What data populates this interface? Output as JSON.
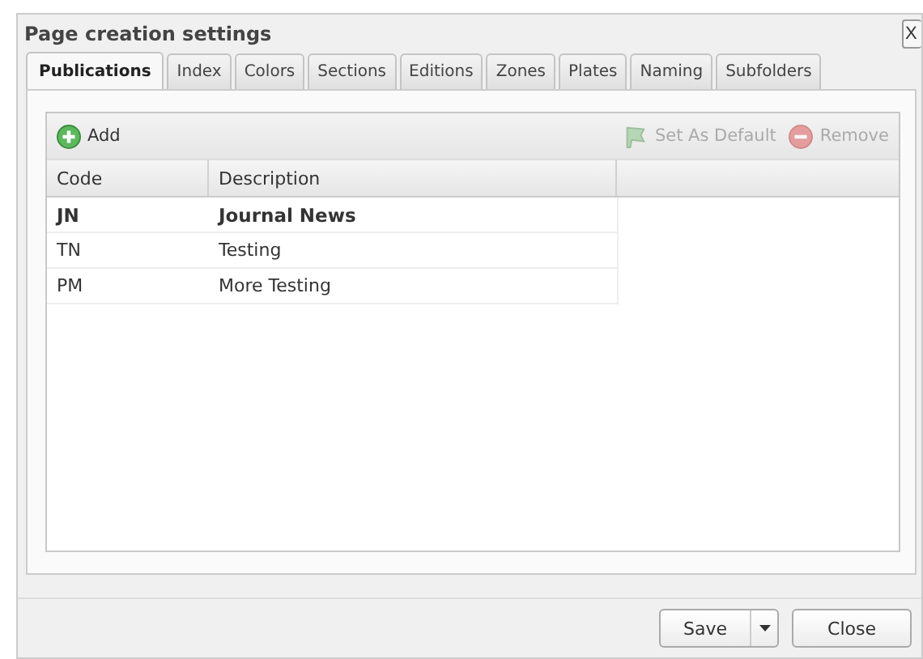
{
  "window": {
    "title": "Page creation settings",
    "close_label": "X"
  },
  "tabs": [
    {
      "label": "Publications",
      "selected": true
    },
    {
      "label": "Index",
      "selected": false
    },
    {
      "label": "Colors",
      "selected": false
    },
    {
      "label": "Sections",
      "selected": false
    },
    {
      "label": "Editions",
      "selected": false
    },
    {
      "label": "Zones",
      "selected": false
    },
    {
      "label": "Plates",
      "selected": false
    },
    {
      "label": "Naming",
      "selected": false
    },
    {
      "label": "Subfolders",
      "selected": false
    }
  ],
  "toolbar": {
    "add": {
      "label": "Add",
      "disabled": false
    },
    "set_default": {
      "label": "Set As Default",
      "disabled": true
    },
    "remove": {
      "label": "Remove",
      "disabled": true
    }
  },
  "table": {
    "columns": [
      "Code",
      "Description"
    ],
    "rows": [
      {
        "code": "JN",
        "description": "Journal News",
        "is_default": true
      },
      {
        "code": "TN",
        "description": "Testing",
        "is_default": false
      },
      {
        "code": "PM",
        "description": "More Testing",
        "is_default": false
      }
    ]
  },
  "buttons": {
    "save": "Save",
    "close": "Close"
  }
}
